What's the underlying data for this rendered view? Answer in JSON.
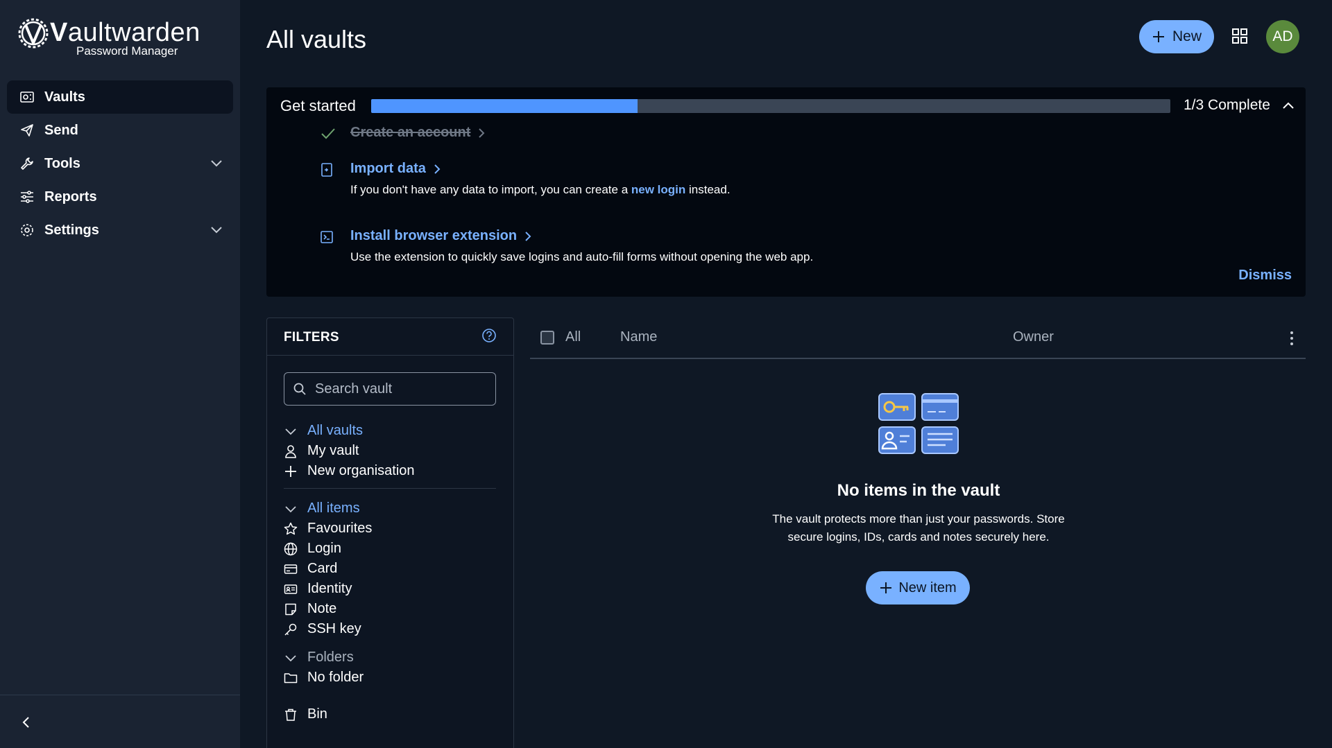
{
  "brand": {
    "name_bold": "V",
    "name_rest": "aultwarden",
    "subtitle": "Password Manager"
  },
  "sidebar": {
    "items": [
      {
        "label": "Vaults",
        "icon": "vault-icon",
        "active": true
      },
      {
        "label": "Send",
        "icon": "send-icon"
      },
      {
        "label": "Tools",
        "icon": "wrench-icon",
        "expandable": true
      },
      {
        "label": "Reports",
        "icon": "sliders-icon"
      },
      {
        "label": "Settings",
        "icon": "gear-icon",
        "expandable": true
      }
    ]
  },
  "header": {
    "title": "All vaults",
    "new_label": "New",
    "avatar_initials": "AD"
  },
  "get_started": {
    "title": "Get started",
    "progress": 0.333,
    "complete_label": "1/3 Complete",
    "dismiss_label": "Dismiss",
    "tasks": [
      {
        "label": "Create an account",
        "done": true
      },
      {
        "label": "Import data",
        "desc_before": "If you don't have any data to import, you can create a ",
        "desc_link": "new login",
        "desc_after": " instead."
      },
      {
        "label": "Install browser extension",
        "desc": "Use the extension to quickly save logins and auto-fill forms without opening the web app."
      }
    ]
  },
  "filters": {
    "title": "FILTERS",
    "search_placeholder": "Search vault",
    "vaults": {
      "header": "All vaults",
      "items": [
        "My vault",
        "New organisation"
      ]
    },
    "types": {
      "header": "All items",
      "items": [
        "Favourites",
        "Login",
        "Card",
        "Identity",
        "Note",
        "SSH key"
      ]
    },
    "folders": {
      "header": "Folders",
      "items": [
        "No folder"
      ]
    },
    "bin_label": "Bin"
  },
  "table": {
    "col_all": "All",
    "col_name": "Name",
    "col_owner": "Owner"
  },
  "empty": {
    "title": "No items in the vault",
    "desc_line1": "The vault protects more than just your passwords. Store",
    "desc_line2": "secure logins, IDs, cards and notes securely here.",
    "button_label": "New item"
  },
  "colors": {
    "accent": "#79b1ff",
    "progress": "#4f95ff",
    "sidebar": "#1a2332",
    "background": "#0f1825",
    "avatar": "#5a8a3c"
  }
}
